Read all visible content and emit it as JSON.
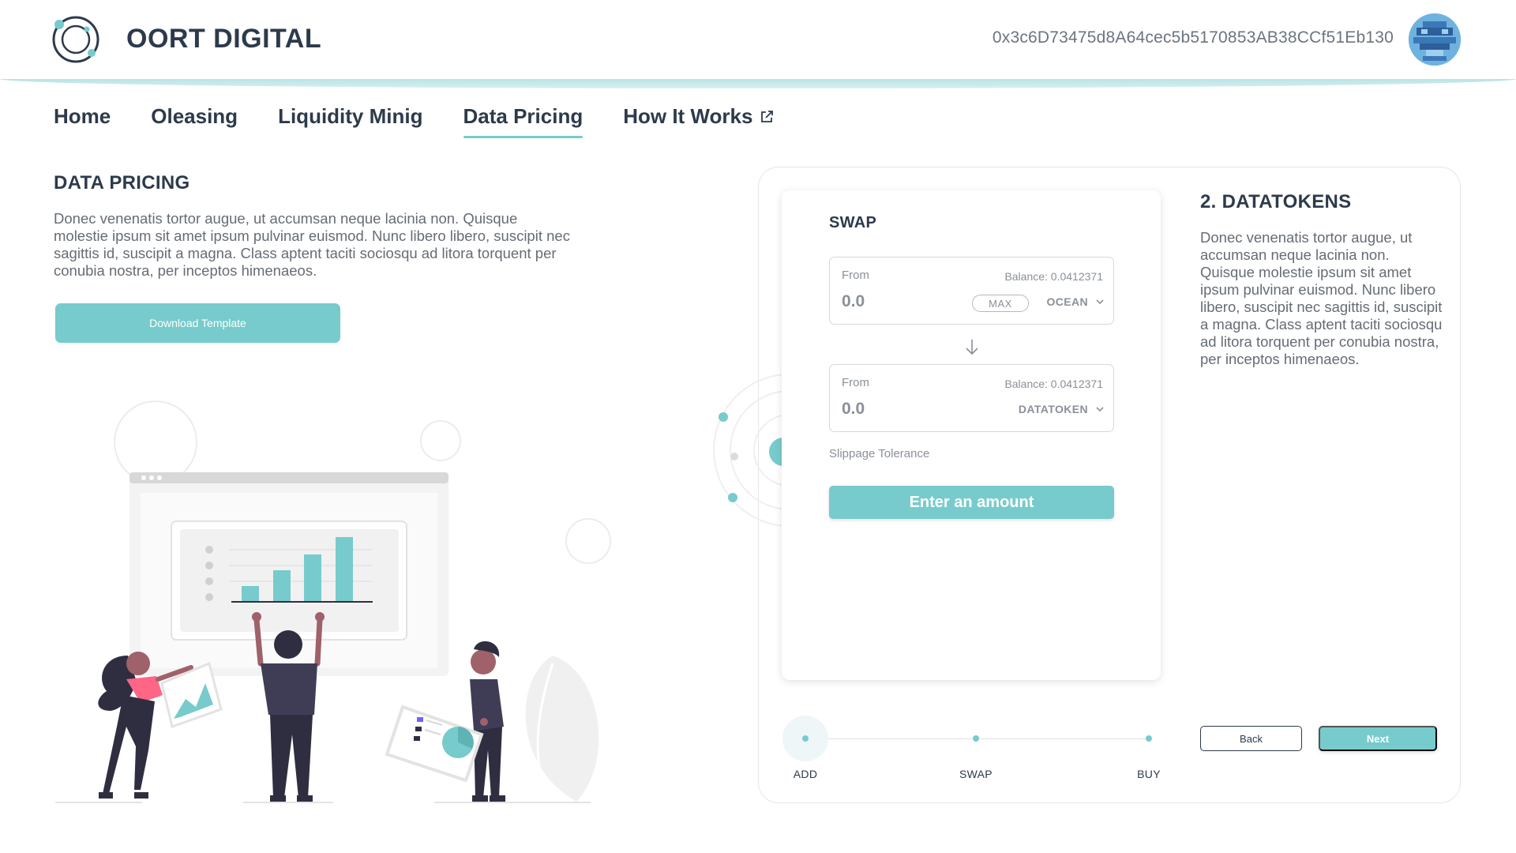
{
  "header": {
    "brand": "OORT DIGITAL",
    "wallet_address": "0x3c6D73475d8A64cec5b5170853AB38CCf51Eb130",
    "logo_icon": "oort-logo-icon",
    "avatar_icon": "pixel-avatar-icon"
  },
  "nav": {
    "items": [
      {
        "label": "Home"
      },
      {
        "label": "Oleasing"
      },
      {
        "label": "Liquidity Minig"
      },
      {
        "label": "Data Pricing"
      },
      {
        "label": "How It Works"
      }
    ],
    "active": "Data Pricing"
  },
  "left": {
    "title": "DATA PRICING",
    "description": "Donec venenatis tortor augue, ut accumsan neque lacinia non. Quisque molestie ipsum sit amet ipsum pulvinar euismod. Nunc libero libero, suscipit nec sagittis id, suscipit a magna. Class aptent taciti sociosqu ad litora torquent per conubia nostra, per inceptos himenaeos.",
    "download_label": "Download Template"
  },
  "swap": {
    "title": "SWAP",
    "from1": {
      "label": "From",
      "balance": "Balance: 0.0412371",
      "value": "0.0",
      "max_label": "MAX",
      "token": "OCEAN"
    },
    "from2": {
      "label": "From",
      "balance": "Balance: 0.0412371",
      "value": "0.0",
      "token": "DATATOKEN"
    },
    "slippage_label": "Slippage Tolerance",
    "enter_label": "Enter an amount"
  },
  "datatokens": {
    "title": "2. DATATOKENS",
    "description": "Donec venenatis tortor augue, ut accumsan neque lacinia non. Quisque molestie ipsum sit amet ipsum pulvinar euismod. Nunc libero libero, suscipit nec sagittis id, suscipit a magna. Class aptent taciti sociosqu ad litora torquent per conubia nostra, per inceptos himenaeos."
  },
  "steps": {
    "items": [
      "ADD",
      "SWAP",
      "BUY"
    ],
    "current": "ADD"
  },
  "buttons": {
    "back": "Back",
    "next": "Next"
  },
  "colors": {
    "accent": "#77cbcc",
    "heading": "#2d3a4b",
    "text": "#666c74"
  }
}
